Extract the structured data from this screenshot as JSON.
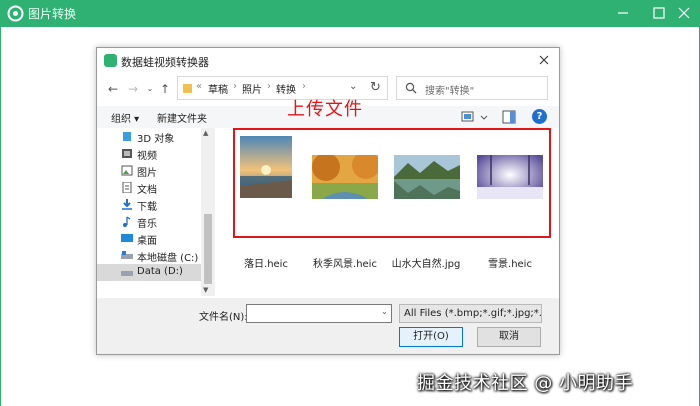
{
  "app": {
    "title": "图片转换",
    "colors": {
      "titlebar": "#2fb174",
      "accent_red": "#e0161b"
    }
  },
  "dialog": {
    "title": "数据蛙视频转换器",
    "breadcrumb": [
      "«",
      "草稿",
      "照片",
      "转换"
    ],
    "search_placeholder": "搜索\"转换\"",
    "toolbar": {
      "organize": "组织 ▾",
      "new_folder": "新建文件夹"
    },
    "nav_items": [
      {
        "label": "3D 对象",
        "icon": "cube-icon"
      },
      {
        "label": "视频",
        "icon": "video-icon"
      },
      {
        "label": "图片",
        "icon": "picture-icon"
      },
      {
        "label": "文档",
        "icon": "document-icon"
      },
      {
        "label": "下载",
        "icon": "download-icon"
      },
      {
        "label": "音乐",
        "icon": "music-icon"
      },
      {
        "label": "桌面",
        "icon": "desktop-icon"
      },
      {
        "label": "本地磁盘 (C:)",
        "icon": "drive-icon"
      },
      {
        "label": "Data (D:)",
        "icon": "drive-icon",
        "selected": true
      }
    ],
    "upload_annotation": "上传文件",
    "files": [
      {
        "name": "落日.heic",
        "thumb": "sunset"
      },
      {
        "name": "秋季风景.heic",
        "thumb": "autumn"
      },
      {
        "name": "山水大自然.jpg",
        "thumb": "mountain-lake"
      },
      {
        "name": "雪景.heic",
        "thumb": "snow"
      }
    ],
    "file_name_label": "文件名(N):",
    "file_name_value": "",
    "file_type": "All Files (*.bmp;*.gif;*.jpg;*.jp",
    "open_button": "打开(O)",
    "cancel_button": "取消"
  },
  "watermark": "掘金技术社区 @ 小明助手"
}
